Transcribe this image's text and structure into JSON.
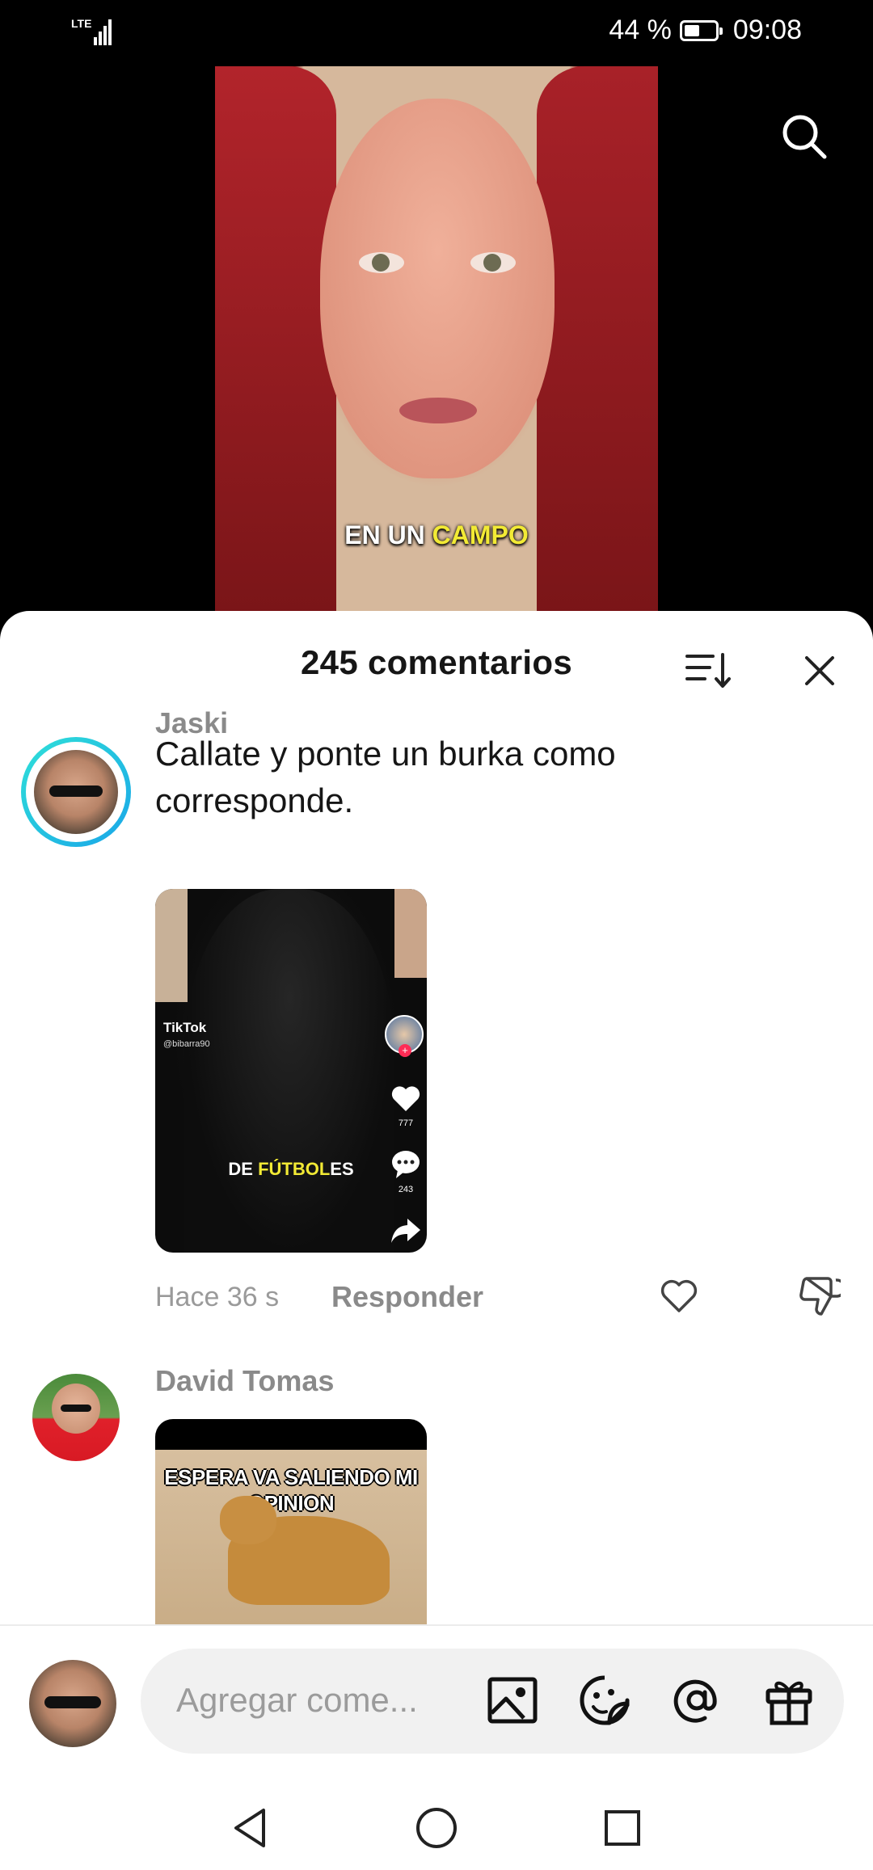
{
  "status_bar": {
    "network": "LTE",
    "battery_percent": "44 %",
    "time": "09:08"
  },
  "video": {
    "caption_plain": "EN UN",
    "caption_highlight": "CAMPO"
  },
  "comments_panel": {
    "title": "245 comentarios",
    "comments": [
      {
        "author": "Jaski",
        "text": "Callate y ponte un burka como corresponde.",
        "attachment": {
          "watermark": "TikTok",
          "watermark_user": "@bibarra90",
          "caption_plain_1": "DE",
          "caption_highlight": "FÚTBOL",
          "caption_plain_2": "ES",
          "likes": "777",
          "comments": "243"
        },
        "time": "Hace 36 s",
        "reply_label": "Responder"
      },
      {
        "author": "David Tomas",
        "attachment": {
          "meme_text": "ESPERA VA SALIENDO MI OPINION"
        }
      }
    ]
  },
  "composer": {
    "placeholder": "Agregar come..."
  }
}
